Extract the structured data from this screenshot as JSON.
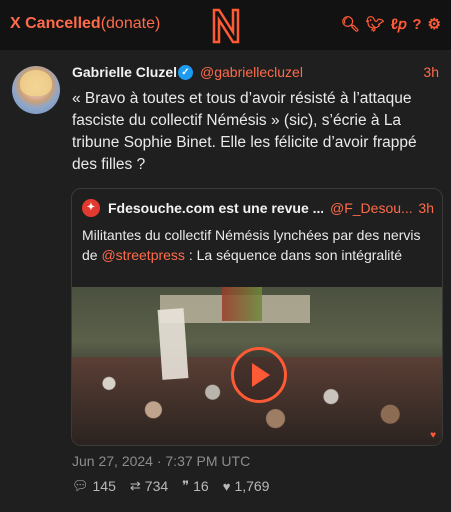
{
  "app": {
    "brand_strong": "X Cancelled",
    "brand_suffix": "(donate)",
    "icons": [
      "search-icon",
      "twitter-bird-icon",
      "liberapay-icon",
      "help-icon",
      "gear-icon"
    ]
  },
  "tweet": {
    "author_name": "Gabrielle Cluzel",
    "handle": "@gabriellecluzel",
    "time": "3h",
    "text": "« Bravo à toutes et tous d’avoir résisté à l’attaque fasciste du collectif Némésis » (sic), s’écrie à La tribune Sophie Binet. Elle les félicite d’avoir frappé des filles ?",
    "quote": {
      "source_name": "Fdesouche.com est une revue ...",
      "source_handle": "@F_Desou...",
      "time": "3h",
      "text_before_link": "Militantes du collectif Némésis lynchées par des nervis de ",
      "link": "@streetpress",
      "text_after_link": " : La séquence dans son intégralité"
    },
    "date": "Jun 27, 2024 · 7:37 PM UTC",
    "stats": {
      "replies": "145",
      "retweets": "734",
      "quotes": "16",
      "likes": "1,769"
    }
  },
  "colors": {
    "accent": "#ff5a36",
    "background": "#1a1a1a",
    "card_background": "#1f1f1f",
    "text": "#eaeaea"
  }
}
